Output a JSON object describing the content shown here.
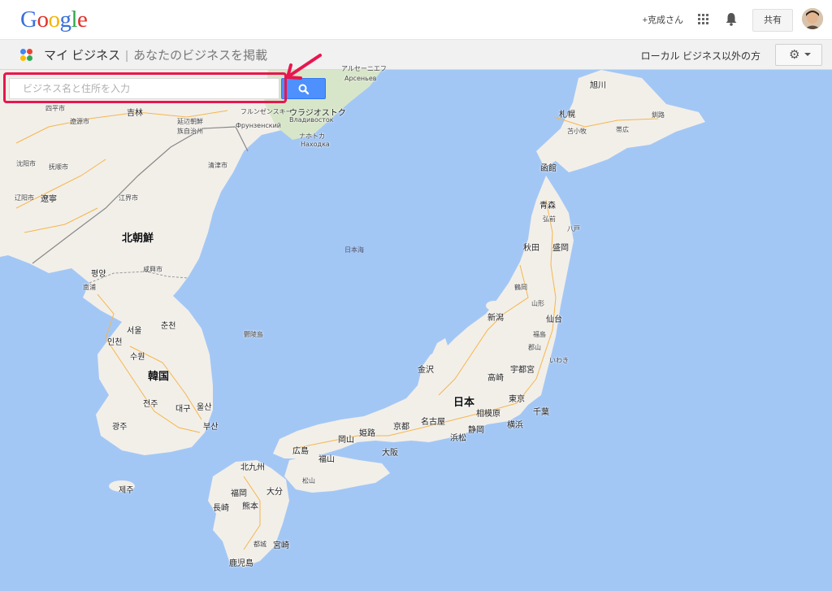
{
  "header": {
    "logo": [
      "G",
      "o",
      "o",
      "g",
      "l",
      "e"
    ],
    "logo_colors": [
      "#3a6fdc",
      "#e0322b",
      "#f5b400",
      "#3a6fdc",
      "#31a64b",
      "#e0322b"
    ],
    "user_name": "+克成さん",
    "apps_icon": "apps-grid-icon",
    "notifications_icon": "bell-icon",
    "share_label": "共有"
  },
  "subheader": {
    "title": "マイ ビジネス",
    "separator": "|",
    "subtitle": "あなたのビジネスを掲載",
    "nonlocal_link": "ローカル ビジネス以外の方",
    "settings_icon": "gear-icon"
  },
  "search": {
    "placeholder": "ビジネス名と住所を入力",
    "value": "",
    "button_icon": "search-icon"
  },
  "map": {
    "labels": [
      {
        "text": "アルセーニエフ",
        "cls": "lbl-s"
      },
      {
        "text": "Арсеньев",
        "cls": "lbl-s"
      },
      {
        "text": "四平市",
        "cls": "lbl-s"
      },
      {
        "text": "吉林",
        "cls": "lbl-m"
      },
      {
        "text": "遼源市",
        "cls": "lbl-s"
      },
      {
        "text": "延辺朝鮮",
        "cls": "lbl-s"
      },
      {
        "text": "族自治州",
        "cls": "lbl-s"
      },
      {
        "text": "フルンゼンスキー",
        "cls": "lbl-s"
      },
      {
        "text": "Фрунзенский",
        "cls": "lbl-s"
      },
      {
        "text": "ウラジオストク",
        "cls": "lbl-m"
      },
      {
        "text": "Владивосток",
        "cls": "lbl-s"
      },
      {
        "text": "ナホトカ",
        "cls": "lbl-s"
      },
      {
        "text": "Находка",
        "cls": "lbl-s"
      },
      {
        "text": "旭川",
        "cls": "lbl-m"
      },
      {
        "text": "札幌",
        "cls": "lbl-m"
      },
      {
        "text": "苫小牧",
        "cls": "lbl-s"
      },
      {
        "text": "帯広",
        "cls": "lbl-s"
      },
      {
        "text": "釧路",
        "cls": "lbl-s"
      },
      {
        "text": "沈阳市",
        "cls": "lbl-s"
      },
      {
        "text": "抚顺市",
        "cls": "lbl-s"
      },
      {
        "text": "清津市",
        "cls": "lbl-s"
      },
      {
        "text": "函館",
        "cls": "lbl-m"
      },
      {
        "text": "辽阳市",
        "cls": "lbl-s"
      },
      {
        "text": "遼寧",
        "cls": "lbl-m"
      },
      {
        "text": "江界市",
        "cls": "lbl-s"
      },
      {
        "text": "青森",
        "cls": "lbl-m"
      },
      {
        "text": "弘前",
        "cls": "lbl-s"
      },
      {
        "text": "八戸",
        "cls": "lbl-s"
      },
      {
        "text": "北朝鮮",
        "cls": "lbl-l"
      },
      {
        "text": "秋田",
        "cls": "lbl-m"
      },
      {
        "text": "盛岡",
        "cls": "lbl-m"
      },
      {
        "text": "日本海",
        "cls": "lbl-sea"
      },
      {
        "text": "咸興市",
        "cls": "lbl-s"
      },
      {
        "text": "평양",
        "cls": "lbl-m"
      },
      {
        "text": "南浦",
        "cls": "lbl-s"
      },
      {
        "text": "鶴岡",
        "cls": "lbl-s"
      },
      {
        "text": "山形",
        "cls": "lbl-s"
      },
      {
        "text": "新潟",
        "cls": "lbl-m"
      },
      {
        "text": "仙台",
        "cls": "lbl-m"
      },
      {
        "text": "춘천",
        "cls": "lbl-m"
      },
      {
        "text": "서울",
        "cls": "lbl-m"
      },
      {
        "text": "인천",
        "cls": "lbl-m"
      },
      {
        "text": "수원",
        "cls": "lbl-m"
      },
      {
        "text": "鬱陵島",
        "cls": "lbl-s"
      },
      {
        "text": "福島",
        "cls": "lbl-s"
      },
      {
        "text": "郡山",
        "cls": "lbl-s"
      },
      {
        "text": "いわき",
        "cls": "lbl-s"
      },
      {
        "text": "金沢",
        "cls": "lbl-m"
      },
      {
        "text": "宇都宮",
        "cls": "lbl-m"
      },
      {
        "text": "韓国",
        "cls": "lbl-l"
      },
      {
        "text": "高崎",
        "cls": "lbl-m"
      },
      {
        "text": "日本",
        "cls": "lbl-l"
      },
      {
        "text": "東京",
        "cls": "lbl-m"
      },
      {
        "text": "千葉",
        "cls": "lbl-m"
      },
      {
        "text": "대구",
        "cls": "lbl-m"
      },
      {
        "text": "울산",
        "cls": "lbl-m"
      },
      {
        "text": "전주",
        "cls": "lbl-m"
      },
      {
        "text": "광주",
        "cls": "lbl-m"
      },
      {
        "text": "부산",
        "cls": "lbl-m"
      },
      {
        "text": "名古屋",
        "cls": "lbl-m"
      },
      {
        "text": "京都",
        "cls": "lbl-m"
      },
      {
        "text": "姫路",
        "cls": "lbl-m"
      },
      {
        "text": "相模原",
        "cls": "lbl-m"
      },
      {
        "text": "横浜",
        "cls": "lbl-m"
      },
      {
        "text": "静岡",
        "cls": "lbl-m"
      },
      {
        "text": "浜松",
        "cls": "lbl-m"
      },
      {
        "text": "広島",
        "cls": "lbl-m"
      },
      {
        "text": "岡山",
        "cls": "lbl-m"
      },
      {
        "text": "大阪",
        "cls": "lbl-m"
      },
      {
        "text": "福山",
        "cls": "lbl-m"
      },
      {
        "text": "北九州",
        "cls": "lbl-m"
      },
      {
        "text": "大分",
        "cls": "lbl-m"
      },
      {
        "text": "福岡",
        "cls": "lbl-m"
      },
      {
        "text": "松山",
        "cls": "lbl-s"
      },
      {
        "text": "제주",
        "cls": "lbl-m"
      },
      {
        "text": "長崎",
        "cls": "lbl-m"
      },
      {
        "text": "熊本",
        "cls": "lbl-m"
      },
      {
        "text": "都城",
        "cls": "lbl-s"
      },
      {
        "text": "宮崎",
        "cls": "lbl-m"
      },
      {
        "text": "鹿児島",
        "cls": "lbl-m"
      }
    ]
  }
}
